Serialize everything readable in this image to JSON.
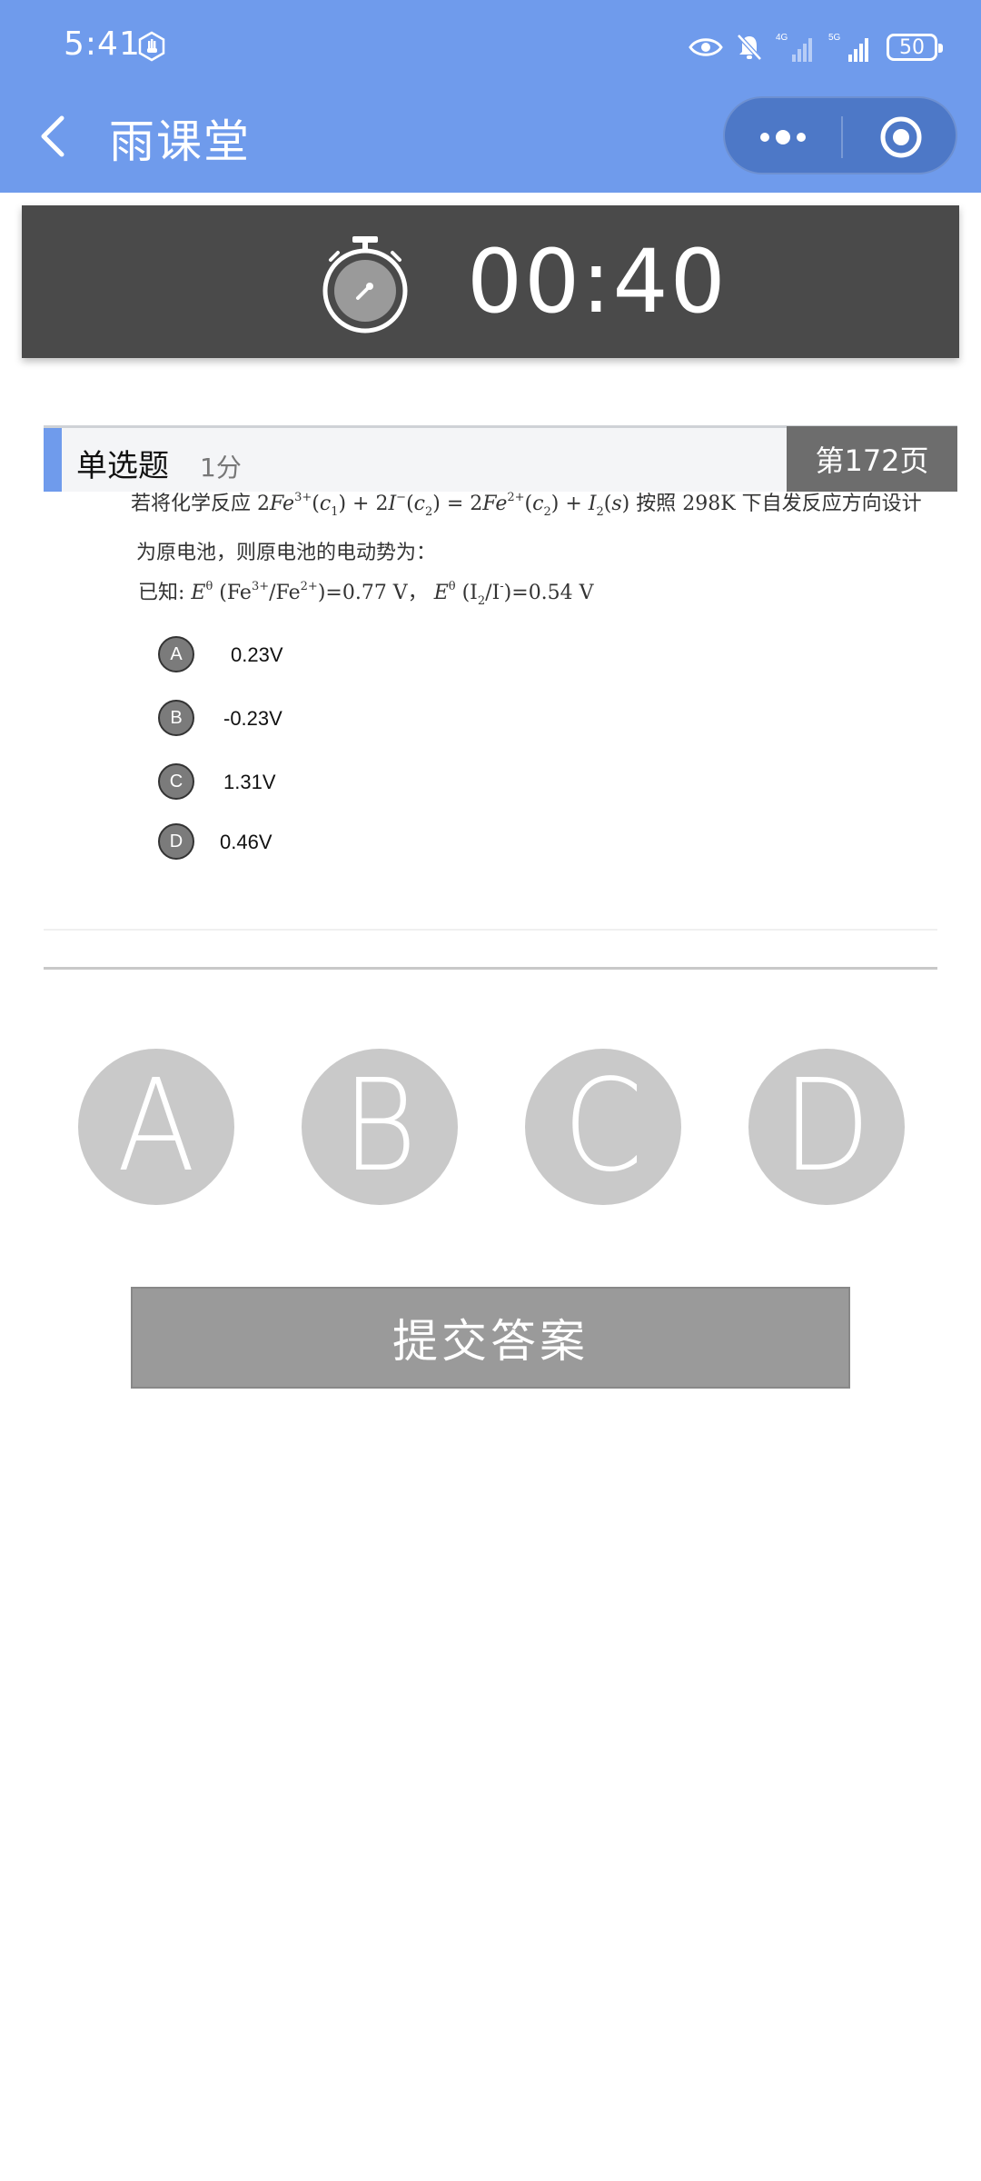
{
  "status_bar": {
    "time": "5:41",
    "network_1": "4G",
    "network_2": "5G",
    "battery": "50"
  },
  "nav": {
    "title": "雨课堂",
    "icons": [
      "back-icon",
      "more-icon",
      "close-target-icon"
    ]
  },
  "timer": {
    "time": "00:40",
    "icon": "stopwatch-icon"
  },
  "question": {
    "type": "单选题",
    "score": "1分",
    "page": "第172页",
    "text_line_2": "为原电池，则原电池的电动势为：",
    "options": [
      {
        "letter": "A",
        "text": "0.23V"
      },
      {
        "letter": "B",
        "text": "-0.23V"
      },
      {
        "letter": "C",
        "text": "1.31V"
      },
      {
        "letter": "D",
        "text": "0.46V"
      }
    ]
  },
  "answers": [
    "A",
    "B",
    "C",
    "D"
  ],
  "submit_label": "提交答案",
  "colors": {
    "header_blue": "#6f9bec",
    "timer_bg": "#4a4a4a",
    "answer_circle": "#c9c9c9",
    "submit_bg": "#9a9a9a"
  }
}
